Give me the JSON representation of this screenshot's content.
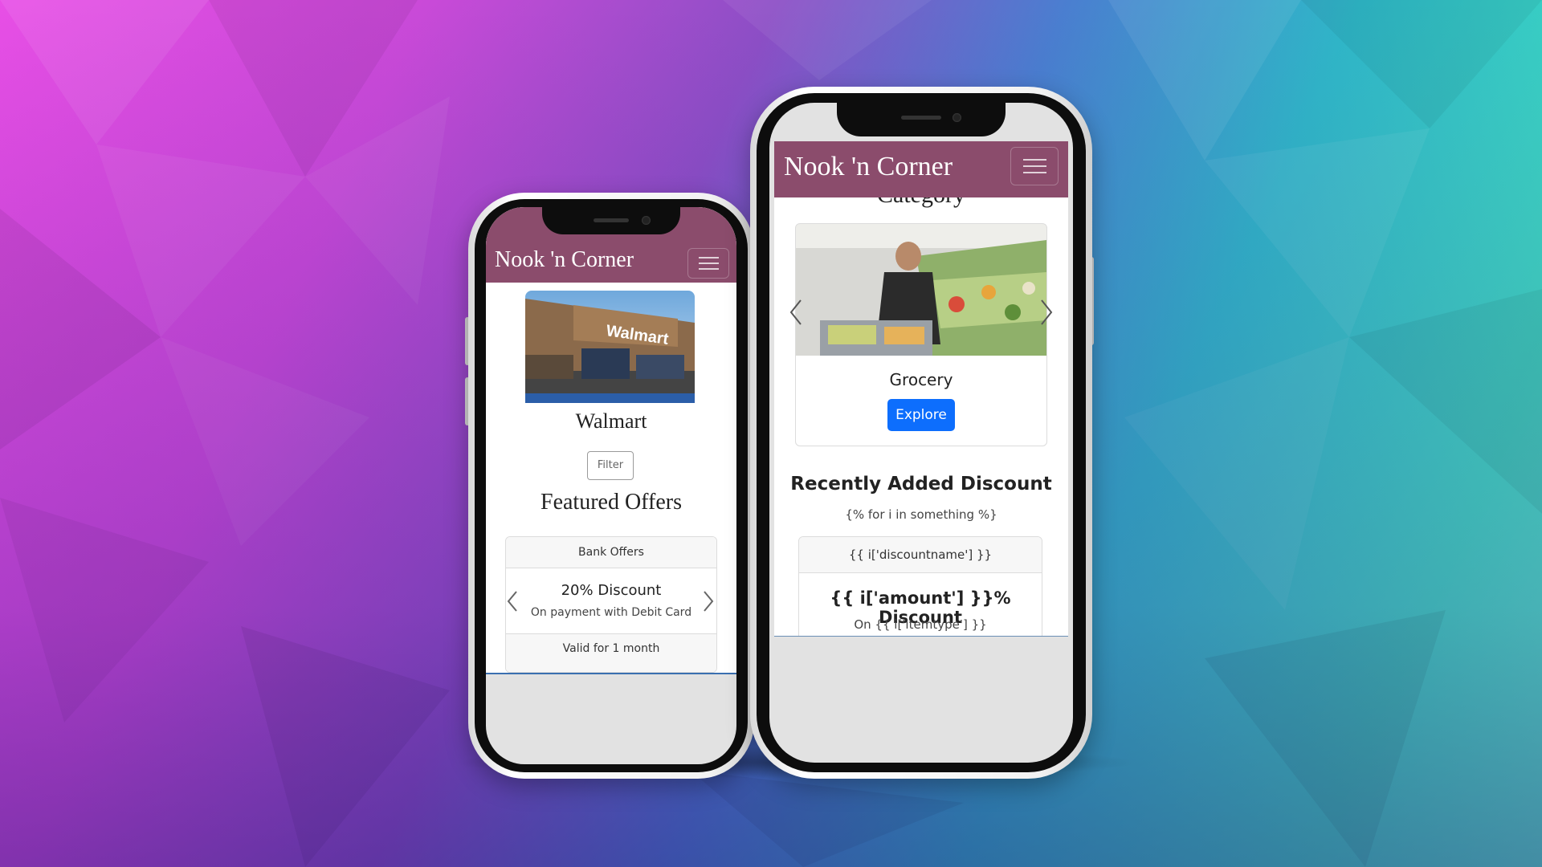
{
  "colors": {
    "navbar": "#8b4c6c",
    "primary_button": "#0d6efd",
    "bg_left": "#e84fe6",
    "bg_right": "#3fe0c0"
  },
  "left_phone": {
    "brand": "Nook 'n Corner",
    "menu_icon": "hamburger-icon",
    "store_name": "Walmart",
    "filter_label": "Filter",
    "section_title": "Featured Offers",
    "offer_card": {
      "header": "Bank Offers",
      "title": "20% Discount",
      "subtitle": "On payment with Debit Card",
      "footer": "Valid for 1 month",
      "prev_icon": "chevron-left-icon",
      "next_icon": "chevron-right-icon"
    }
  },
  "right_phone": {
    "brand": "Nook 'n Corner",
    "menu_icon": "hamburger-icon",
    "partial_heading": "Category",
    "category_card": {
      "name": "Grocery",
      "button_label": "Explore",
      "prev_icon": "chevron-left-icon",
      "next_icon": "chevron-right-icon"
    },
    "section_title": "Recently Added Discount",
    "template_loop": "{% for i in something %}",
    "discount_card": {
      "header": "{{ i['discountname'] }}",
      "title": "{{ i['amount'] }}% Discount",
      "subtitle": "On {{ i['itemtype'] }}"
    }
  }
}
